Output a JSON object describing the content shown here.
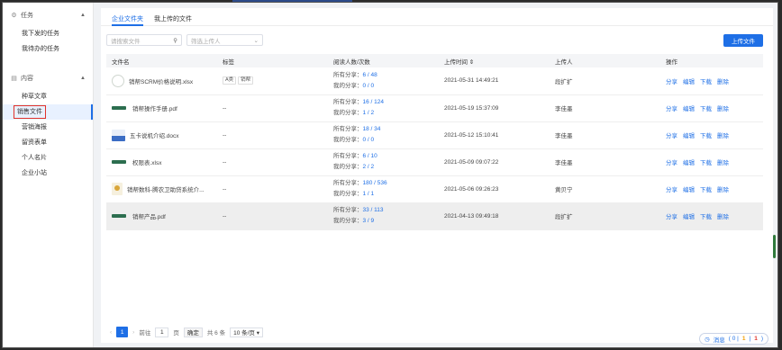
{
  "sidebar": {
    "groups": [
      {
        "label": "任务",
        "items": [
          "我下发的任务",
          "我待办的任务"
        ]
      },
      {
        "label": "内容",
        "items": [
          "种草文章",
          "销售文件",
          "营销海报",
          "留资表单",
          "个人名片",
          "企业小站"
        ]
      }
    ],
    "active_item": "销售文件"
  },
  "tabs": [
    "企业文件夹",
    "我上传的文件"
  ],
  "active_tab": "企业文件夹",
  "search": {
    "placeholder": "请搜索文件"
  },
  "uploader_filter": {
    "placeholder": "筛选上传人"
  },
  "upload_button": "上传文件",
  "table": {
    "headers": [
      "文件名",
      "标签",
      "阅读人数/次数",
      "上传时间 ⇕",
      "上传人",
      "操作"
    ],
    "rows": [
      {
        "name": "销帮SCRM价格说明.xlsx",
        "thumb": "crm",
        "tags": [
          "A类",
          "销帮"
        ],
        "all_label": "所有分享：",
        "all_value": "6 / 48",
        "mine_label": "我的分享：",
        "mine_value": "0 / 0",
        "time": "2021-05-31 14:49:21",
        "uploader": "段扩扩"
      },
      {
        "name": "销帮操作手册.pdf",
        "thumb": "logo",
        "tags_text": "--",
        "all_label": "所有分享：",
        "all_value": "16 / 124",
        "mine_label": "我的分享：",
        "mine_value": "1 / 2",
        "time": "2021-05-19 15:37:09",
        "uploader": "李佳墨"
      },
      {
        "name": "五卡说机介绍.docx",
        "thumb": "doc",
        "tags_text": "--",
        "all_label": "所有分享：",
        "all_value": "18 / 34",
        "mine_label": "我的分享：",
        "mine_value": "0 / 0",
        "time": "2021-05-12 15:10:41",
        "uploader": "李佳墨"
      },
      {
        "name": "权限表.xlsx",
        "thumb": "logo",
        "tags_text": "--",
        "all_label": "所有分享：",
        "all_value": "6 / 10",
        "mine_label": "我的分享：",
        "mine_value": "2 / 2",
        "time": "2021-05-09 09:07:22",
        "uploader": "李佳墨"
      },
      {
        "name": "销帮数科-腾农卫助贷系统介...",
        "thumb": "cert",
        "tags_text": "--",
        "all_label": "所有分享：",
        "all_value": "180 / 536",
        "mine_label": "我的分享：",
        "mine_value": "1 / 1",
        "time": "2021-05-06 09:26:23",
        "uploader": "黄贝宁"
      },
      {
        "name": "销帮产品.pdf",
        "thumb": "logo",
        "tags_text": "--",
        "all_label": "所有分享：",
        "all_value": "33 / 113",
        "mine_label": "我的分享：",
        "mine_value": "3 / 9",
        "time": "2021-04-13 09:49:18",
        "uploader": "段扩扩"
      }
    ],
    "ops": [
      "分享",
      "编辑",
      "下载",
      "删除"
    ]
  },
  "pager": {
    "current": "1",
    "goto_label": "前往",
    "goto_value": "1",
    "page_unit": "页",
    "confirm": "确定",
    "total": "共 6 条",
    "page_size": "10 条/页 ▾"
  },
  "messages": {
    "label": "消息",
    "values": [
      "0",
      "1",
      "1"
    ]
  },
  "colors": {
    "primary": "#1e6fe6",
    "highlight": "#e0322b"
  }
}
